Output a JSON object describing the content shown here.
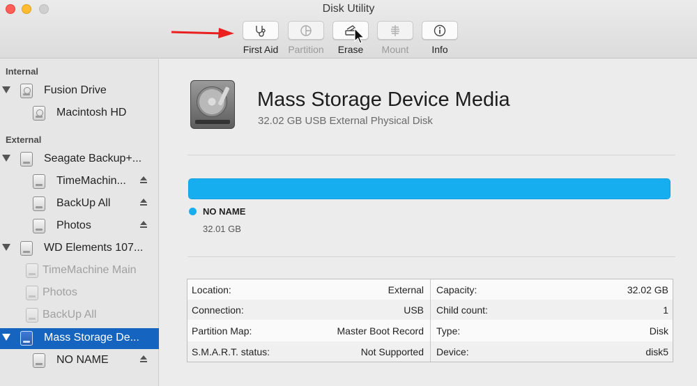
{
  "window": {
    "title": "Disk Utility"
  },
  "toolbar": {
    "buttons": [
      {
        "label": "First Aid",
        "icon": "stethoscope-icon",
        "enabled": true
      },
      {
        "label": "Partition",
        "icon": "pie-chart-icon",
        "enabled": false
      },
      {
        "label": "Erase",
        "icon": "erase-disk-icon",
        "enabled": true
      },
      {
        "label": "Mount",
        "icon": "mount-icon",
        "enabled": false
      },
      {
        "label": "Info",
        "icon": "info-icon",
        "enabled": true
      }
    ]
  },
  "sidebar": {
    "sections": [
      {
        "header": "Internal"
      },
      {
        "header": "External"
      }
    ],
    "items": [
      {
        "name": "Fusion Drive",
        "level": 0,
        "expanded": true,
        "type": "internal"
      },
      {
        "name": "Macintosh HD",
        "level": 1,
        "type": "internal"
      },
      {
        "name": "Seagate Backup+...",
        "level": 0,
        "expanded": true,
        "type": "external"
      },
      {
        "name": "TimeMachin...",
        "level": 1,
        "type": "external",
        "eject": true
      },
      {
        "name": "BackUp All",
        "level": 1,
        "type": "external",
        "eject": true
      },
      {
        "name": "Photos",
        "level": 1,
        "type": "external",
        "eject": true
      },
      {
        "name": "WD Elements 107...",
        "level": 0,
        "expanded": true,
        "type": "external"
      },
      {
        "name": "TimeMachine Main",
        "level": 1,
        "type": "external",
        "dimmed": true
      },
      {
        "name": "Photos",
        "level": 1,
        "type": "external",
        "dimmed": true
      },
      {
        "name": "BackUp All",
        "level": 1,
        "type": "external",
        "dimmed": true
      },
      {
        "name": "Mass Storage De...",
        "level": 0,
        "expanded": true,
        "type": "external",
        "selected": true
      },
      {
        "name": "NO NAME",
        "level": 1,
        "type": "external",
        "eject": true
      }
    ]
  },
  "device": {
    "title": "Mass Storage Device Media",
    "subtitle": "32.02 GB USB External Physical Disk",
    "usage_color": "#17aef0",
    "partition": {
      "name": "NO NAME",
      "size": "32.01 GB"
    }
  },
  "info": {
    "rows": [
      {
        "k1": "Location:",
        "v1": "External",
        "k2": "Capacity:",
        "v2": "32.02 GB"
      },
      {
        "k1": "Connection:",
        "v1": "USB",
        "k2": "Child count:",
        "v2": "1"
      },
      {
        "k1": "Partition Map:",
        "v1": "Master Boot Record",
        "k2": "Type:",
        "v2": "Disk"
      },
      {
        "k1": "S.M.A.R.T. status:",
        "v1": "Not Supported",
        "k2": "Device:",
        "v2": "disk5"
      }
    ]
  }
}
